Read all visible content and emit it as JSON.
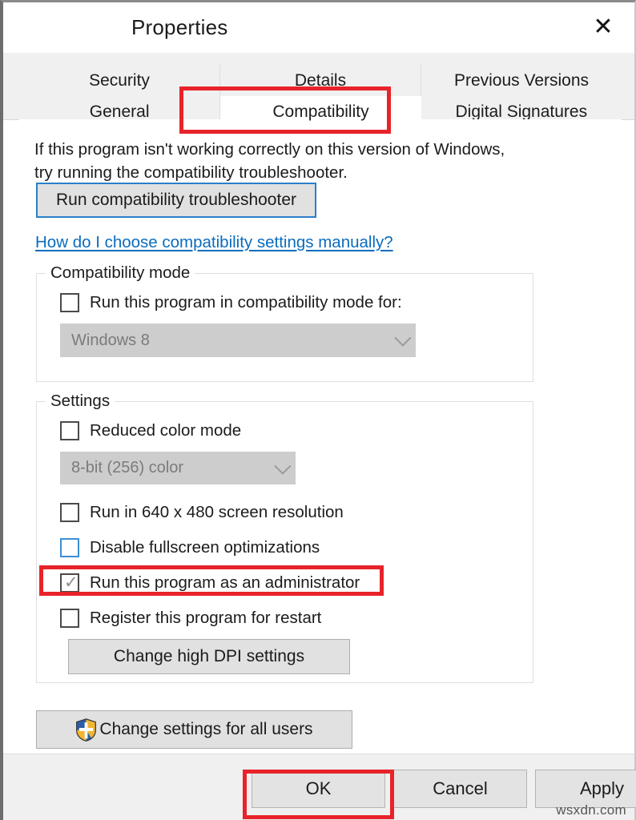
{
  "window": {
    "title": "Properties",
    "close_icon": "close-icon"
  },
  "tabs": {
    "row1": [
      {
        "label": "Security",
        "selected": false
      },
      {
        "label": "Details",
        "selected": false
      },
      {
        "label": "Previous Versions",
        "selected": false
      }
    ],
    "row2": [
      {
        "label": "General",
        "selected": false
      },
      {
        "label": "Compatibility",
        "selected": true
      },
      {
        "label": "Digital Signatures",
        "selected": false
      }
    ]
  },
  "content": {
    "intro_line1": "If this program isn't working correctly on this version of Windows,",
    "intro_line2": "try running the compatibility troubleshooter.",
    "troubleshooter_button": "Run compatibility troubleshooter",
    "help_link": "How do I choose compatibility settings manually?"
  },
  "compatibility_mode": {
    "group_title": "Compatibility mode",
    "checkbox_label": "Run this program in compatibility mode for:",
    "checkbox_checked": false,
    "combo_value": "Windows 8",
    "combo_disabled": true
  },
  "settings": {
    "group_title": "Settings",
    "reduced_color": {
      "label": "Reduced color mode",
      "checked": false
    },
    "color_depth_combo": {
      "value": "8-bit (256) color",
      "disabled": true
    },
    "items": [
      {
        "label": "Run in 640 x 480 screen resolution",
        "checked": false,
        "focused": false
      },
      {
        "label": "Disable fullscreen optimizations",
        "checked": false,
        "focused": true
      },
      {
        "label": "Run this program as an administrator",
        "checked": true,
        "focused": false
      },
      {
        "label": "Register this program for restart",
        "checked": false,
        "focused": false
      }
    ],
    "dpi_button": "Change high DPI settings"
  },
  "all_users": {
    "button_label": "Change settings for all users",
    "icon": "uac-shield-icon"
  },
  "footer": {
    "ok": "OK",
    "cancel": "Cancel",
    "apply": "Apply"
  },
  "watermark": "wsxdn.com",
  "annotations": {
    "highlight_color": "#e8232a",
    "targets": [
      "Compatibility tab",
      "Run this program as an administrator",
      "OK"
    ]
  },
  "glyphs": {
    "close": "✕",
    "check": "✓"
  }
}
